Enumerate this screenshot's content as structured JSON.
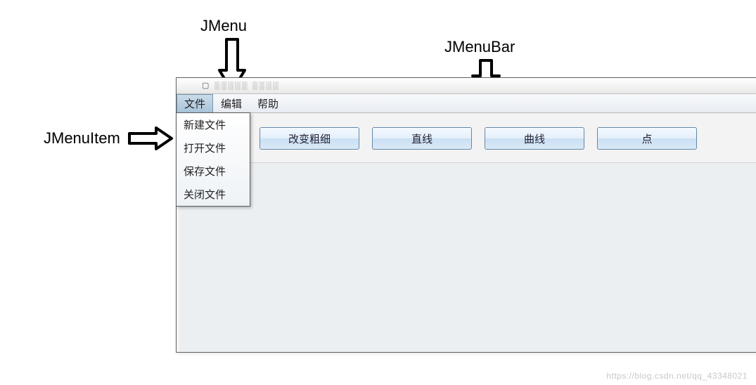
{
  "labels": {
    "jmenu": "JMenu",
    "jmenubar": "JMenuBar",
    "jmenuitem": "JMenuItem"
  },
  "window": {
    "titlebar_noise": "▢ ░░░░░   ░░░░"
  },
  "menubar": {
    "items": [
      {
        "label": "文件"
      },
      {
        "label": "编辑"
      },
      {
        "label": "帮助"
      }
    ]
  },
  "dropdown": {
    "items": [
      {
        "label": "新建文件"
      },
      {
        "label": "打开文件"
      },
      {
        "label": "保存文件"
      },
      {
        "label": "关闭文件"
      }
    ]
  },
  "toolbar": {
    "buttons": [
      {
        "label": "改变粗细"
      },
      {
        "label": "直线"
      },
      {
        "label": "曲线"
      },
      {
        "label": "点"
      }
    ]
  },
  "watermark": "https://blog.csdn.net/qq_43348021"
}
